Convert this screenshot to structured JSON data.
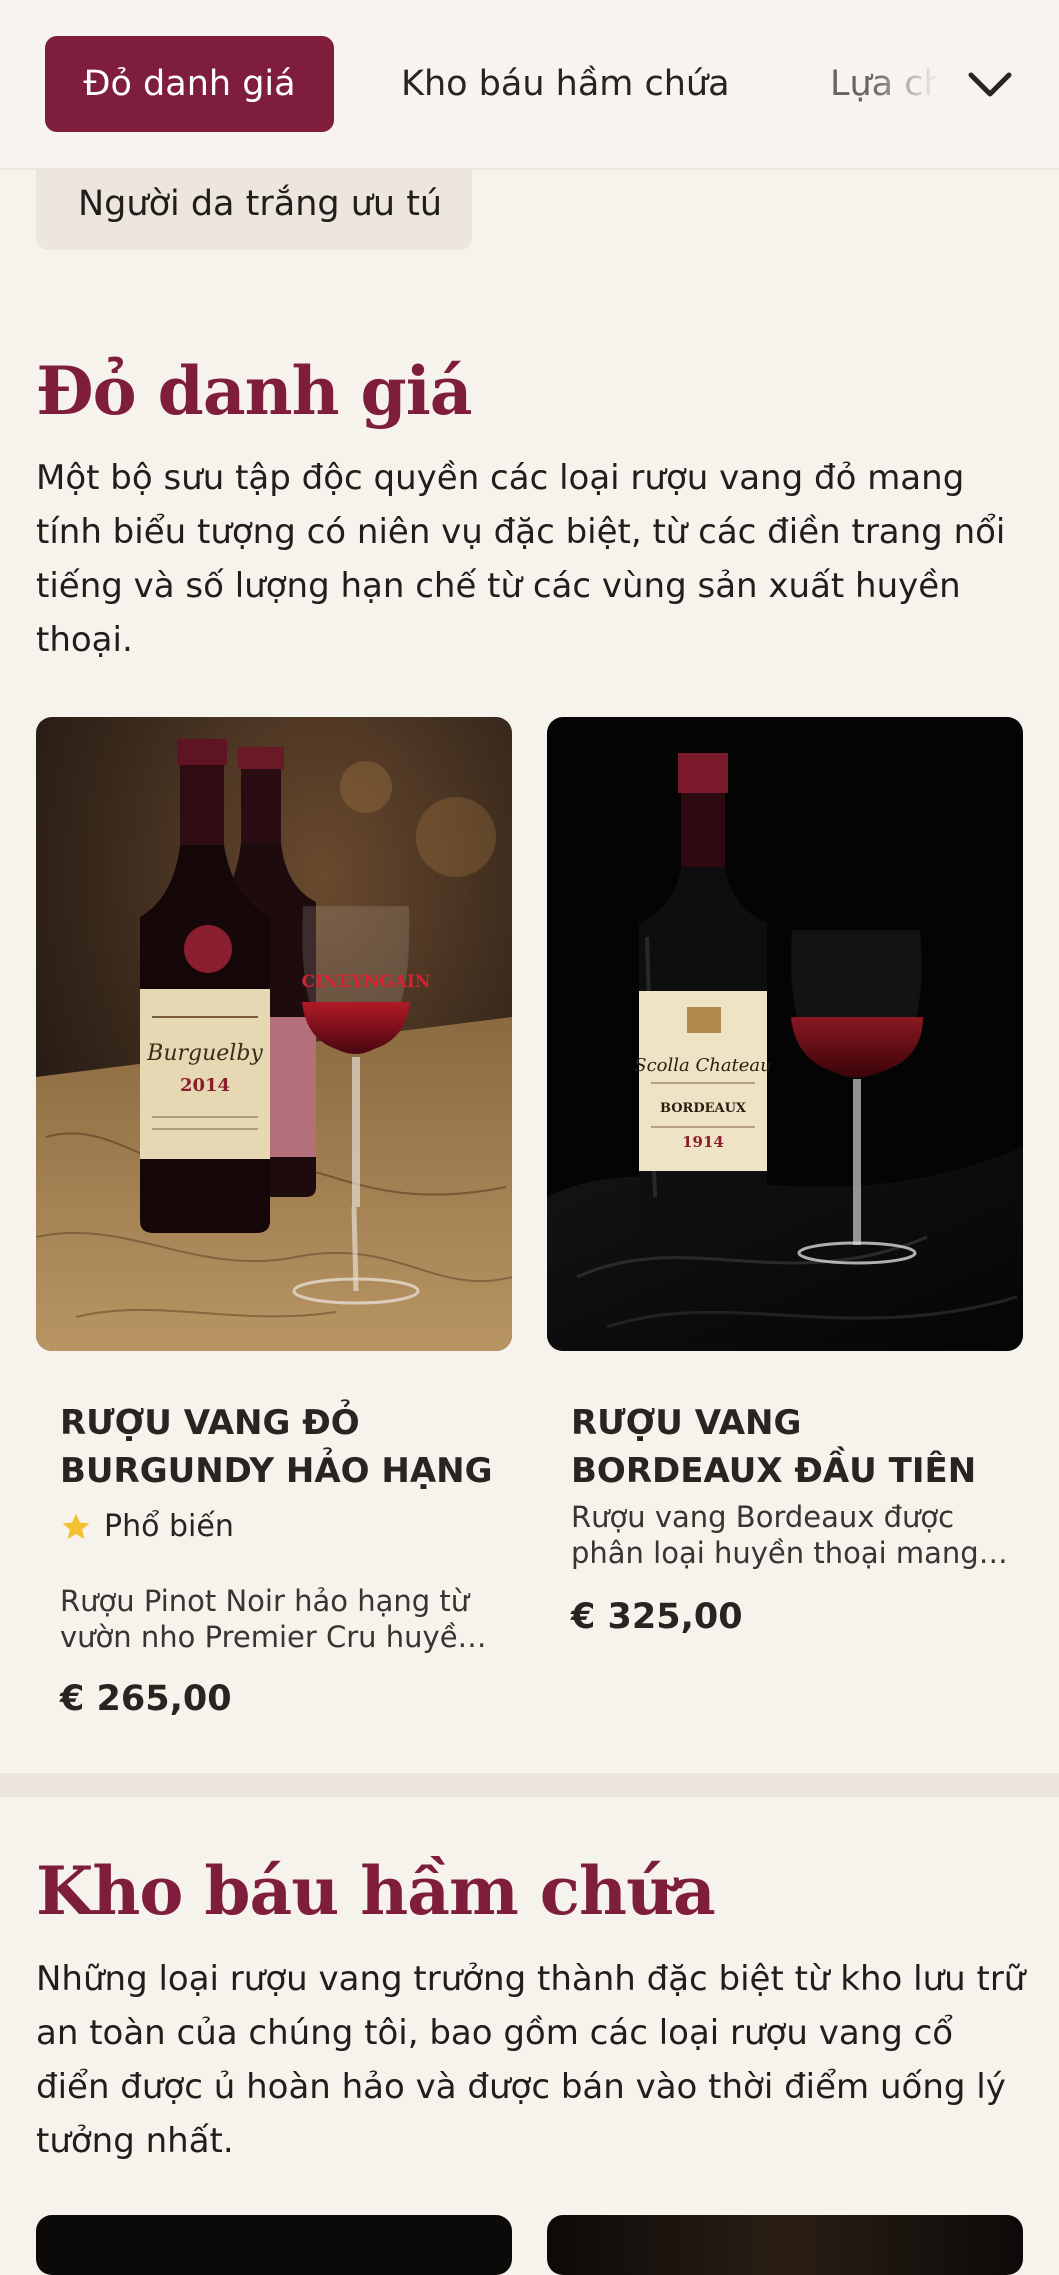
{
  "nav": {
    "tabs": [
      {
        "label": "Đỏ danh giá",
        "active": true
      },
      {
        "label": "Kho báu hầm chứa",
        "active": false
      },
      {
        "label": "Lựa chọn",
        "active": false
      }
    ],
    "dropdown_icon": "chevron-down-icon"
  },
  "subcategory": {
    "label": "Người da trắng ưu tú"
  },
  "sections": [
    {
      "title": "Đỏ danh giá",
      "description": "Một bộ sưu tập độc quyền các loại rượu vang đỏ mang tính biểu tượng có niên vụ đặc biệt, từ các điền trang nổi tiếng và số lượng hạn chế từ các vùng sản xuất huyền thoại.",
      "products": [
        {
          "name": "RƯỢU VANG ĐỎ BURGUNDY HẢO HẠNG",
          "badge": "Phổ biến",
          "badge_icon": "star-icon",
          "description": "Rượu Pinot Noir hảo hạng từ vườn nho Premier Cru huyền thoại",
          "price": "€ 265,00",
          "label_text": {
            "brand": "Burguelby",
            "year": "2014",
            "glass": "CINEYNGAIN"
          }
        },
        {
          "name": "RƯỢU VANG BORDEAUX ĐẦU TIÊN",
          "badge": "",
          "description": "Rượu vang Bordeaux được phân loại huyền thoại mang hương vị đặc trưng",
          "price": "€ 325,00",
          "label_text": {
            "brand": "Scolla Chateau",
            "region": "BORDEAUX",
            "year": "1914"
          }
        }
      ]
    },
    {
      "title": "Kho báu hầm chứa",
      "description": "Những loại rượu vang trưởng thành đặc biệt từ kho lưu trữ an toàn của chúng tôi, bao gồm các loại rượu vang cổ điển được ủ hoàn hảo và được bán vào thời điểm uống lý tưởng nhất."
    }
  ],
  "colors": {
    "accent": "#7f1d3c",
    "background": "#f6f2ec",
    "chip": "#ede6df",
    "star": "#f2c230"
  }
}
